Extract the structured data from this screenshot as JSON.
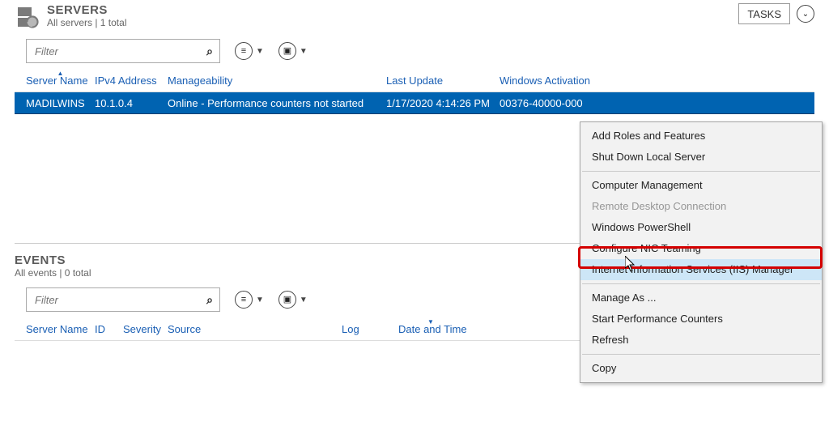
{
  "servers": {
    "title": "SERVERS",
    "subtitle": "All servers | 1 total",
    "tasks_label": "TASKS",
    "filter_placeholder": "Filter",
    "columns": {
      "server_name": "Server Name",
      "ipv4": "IPv4 Address",
      "manage": "Manageability",
      "last_update": "Last Update",
      "activation": "Windows Activation"
    },
    "rows": [
      {
        "server_name": "MADILWINS",
        "ipv4": "10.1.0.4",
        "manage": "Online - Performance counters not started",
        "last_update": "1/17/2020 4:14:26 PM",
        "activation": "00376-40000-000"
      }
    ]
  },
  "events": {
    "title": "EVENTS",
    "subtitle": "All events | 0 total",
    "filter_placeholder": "Filter",
    "columns": {
      "server_name": "Server Name",
      "id": "ID",
      "severity": "Severity",
      "source": "Source",
      "log": "Log",
      "datetime": "Date and Time"
    }
  },
  "context_menu": {
    "items": [
      {
        "label": "Add Roles and Features",
        "disabled": false
      },
      {
        "label": "Shut Down Local Server",
        "disabled": false
      }
    ],
    "group2": [
      {
        "label": "Computer Management",
        "disabled": false
      },
      {
        "label": "Remote Desktop Connection",
        "disabled": true
      },
      {
        "label": "Windows PowerShell",
        "disabled": false
      },
      {
        "label": "Configure NIC Teaming",
        "disabled": false
      },
      {
        "label": "Internet Information Services (IIS) Manager",
        "disabled": false,
        "hover": true
      }
    ],
    "group3": [
      {
        "label": "Manage As ...",
        "disabled": false
      },
      {
        "label": "Start Performance Counters",
        "disabled": false
      },
      {
        "label": "Refresh",
        "disabled": false
      }
    ],
    "group4": [
      {
        "label": "Copy",
        "disabled": false
      }
    ]
  }
}
